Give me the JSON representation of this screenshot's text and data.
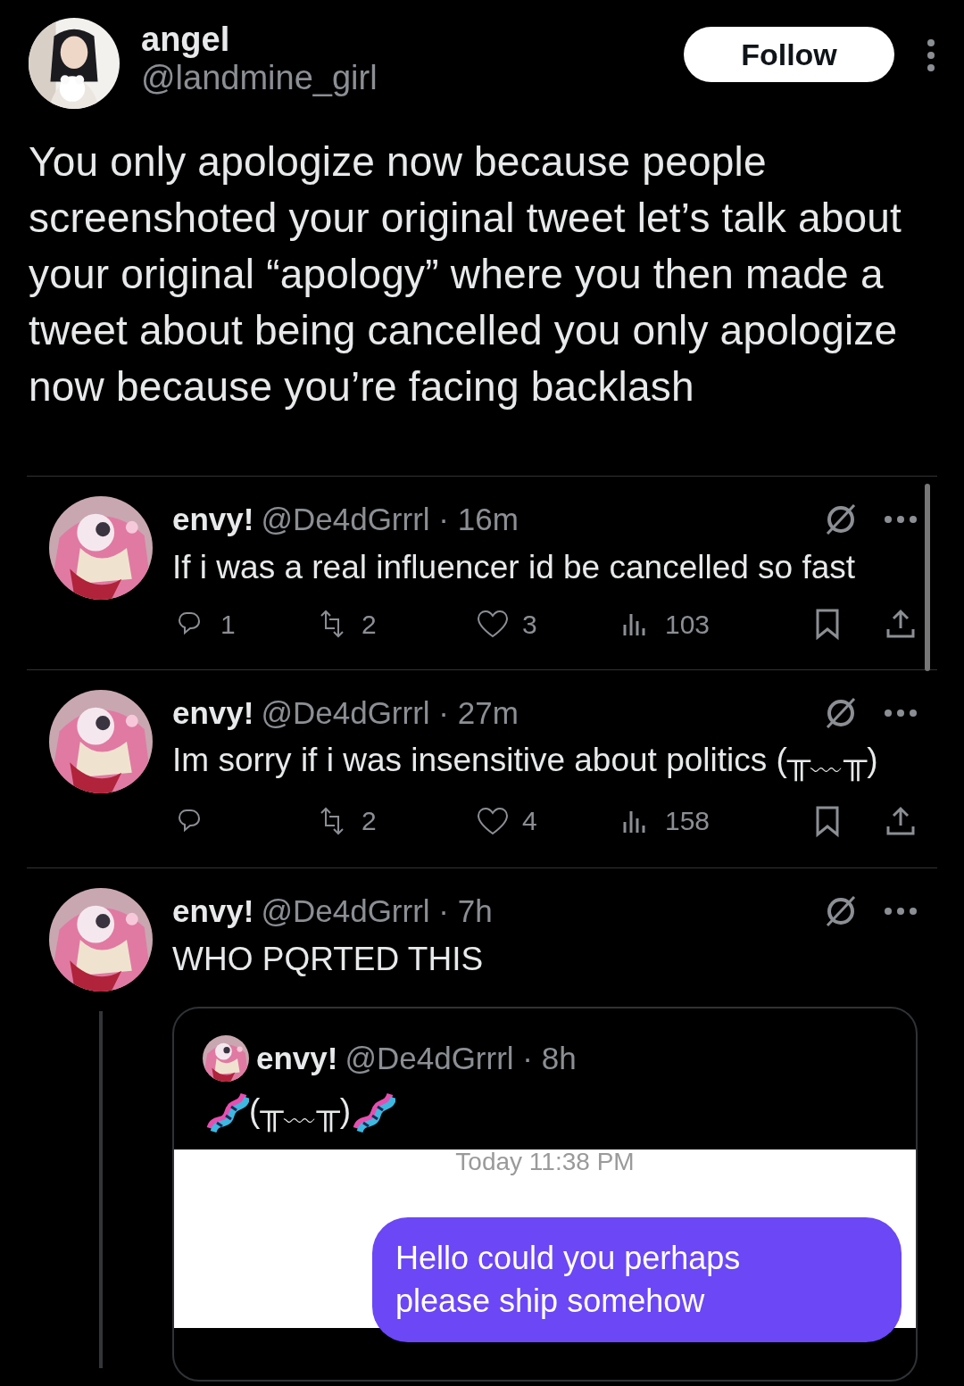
{
  "post": {
    "name": "angel",
    "handle": "@landmine_girl",
    "follow_label": "Follow",
    "text": "You only apologize now because people screenshoted your original tweet let’s talk about your original “apology” where you then made a tweet about being cancelled you only apologize now because you’re facing backlash"
  },
  "replies": [
    {
      "name": "envy!",
      "meta": "@De4dGrrrl · 16m",
      "text": "If i was a real influencer id be cancelled so fast",
      "stats": {
        "replies": "1",
        "retweets": "2",
        "likes": "3",
        "views": "103"
      }
    },
    {
      "name": "envy!",
      "meta": "@De4dGrrrl · 27m",
      "text": "Im sorry if i was insensitive about politics (╥﹏╥)",
      "stats": {
        "retweets": "2",
        "likes": "4",
        "views": "158"
      }
    },
    {
      "name": "envy!",
      "meta": "@De4dGrrrl · 7h",
      "text": "WHO PQRTED THIS",
      "thread": true,
      "quote": {
        "name": "envy!",
        "meta": "@De4dGrrrl · 8h",
        "text": "(╥﹏╥)",
        "image": {
          "timestamp": "Today 11:38 PM",
          "bubble": "Hello could you perhaps please ship somehow"
        }
      }
    }
  ]
}
